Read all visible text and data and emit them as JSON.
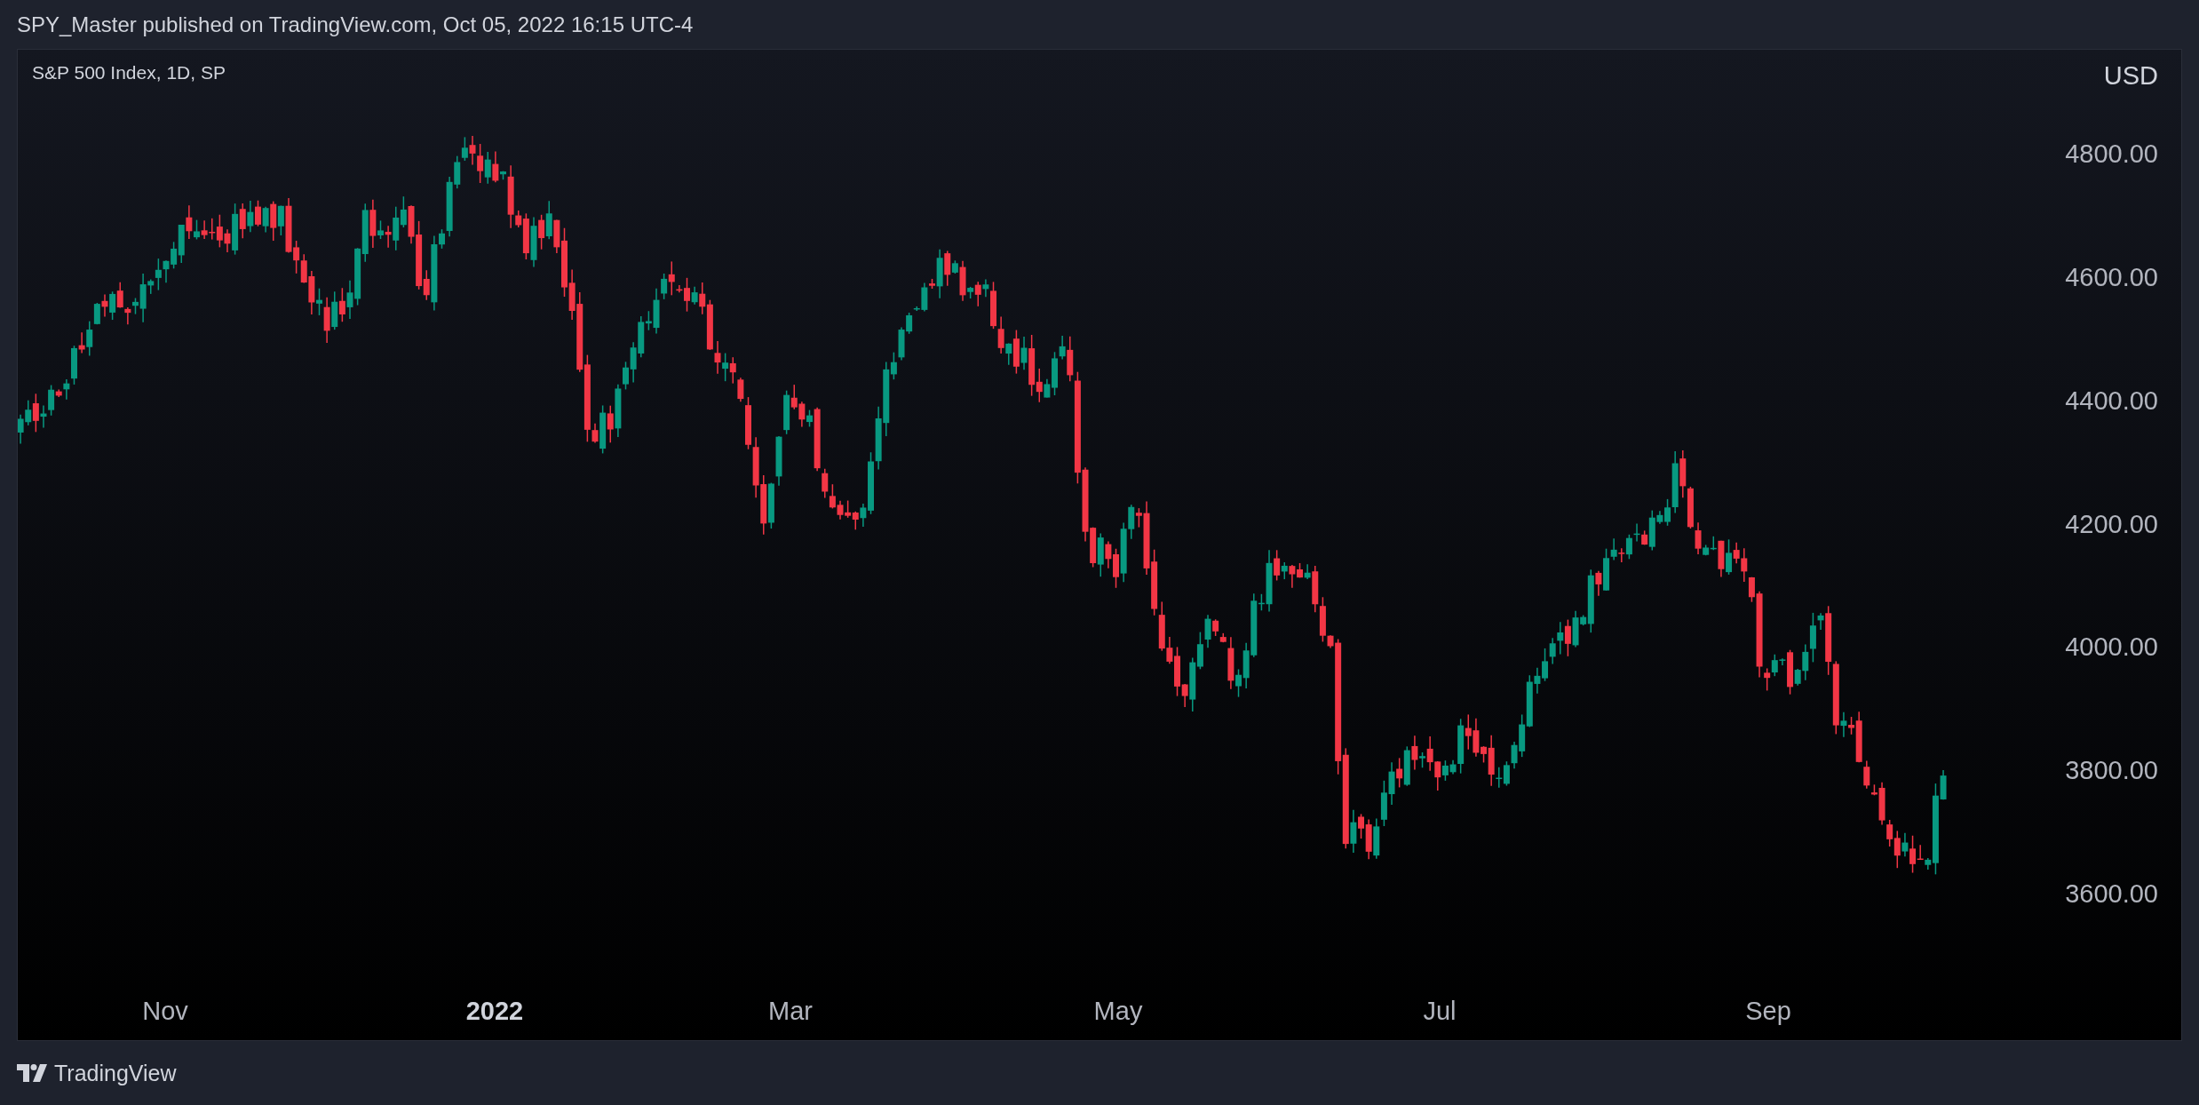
{
  "header": {
    "text": "SPY_Master published on TradingView.com, Oct 05, 2022 16:15 UTC-4"
  },
  "chart": {
    "legend": "S&P 500 Index, 1D, SP",
    "currency": "USD",
    "price_labels": [
      "4800.00",
      "4600.00",
      "4400.00",
      "4200.00",
      "4000.00",
      "3800.00",
      "3600.00"
    ],
    "time_labels": [
      {
        "label": "Nov",
        "kind": "month"
      },
      {
        "label": "2022",
        "kind": "year"
      },
      {
        "label": "Mar",
        "kind": "month"
      },
      {
        "label": "May",
        "kind": "month"
      },
      {
        "label": "Jul",
        "kind": "month"
      },
      {
        "label": "Sep",
        "kind": "month"
      }
    ]
  },
  "footer": {
    "brand": "TradingView"
  }
}
